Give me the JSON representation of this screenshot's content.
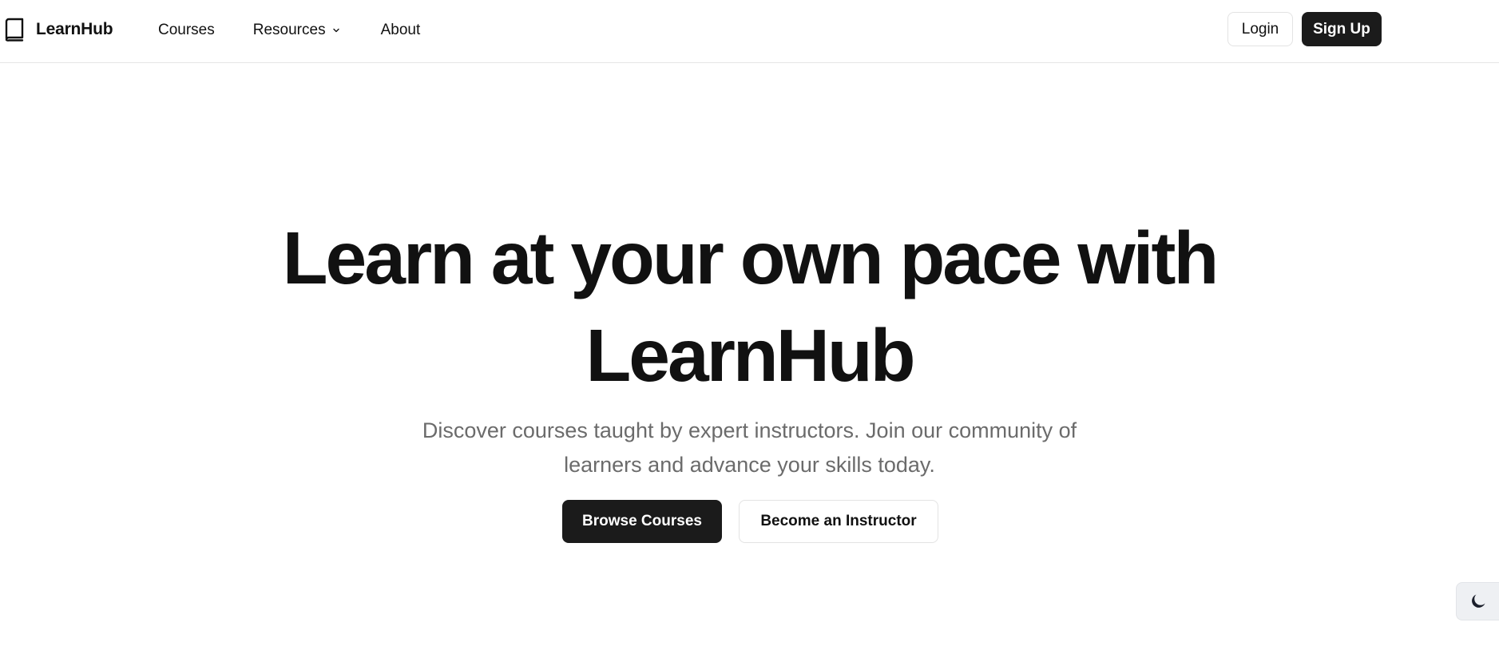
{
  "brand": {
    "name": "LearnHub",
    "icon": "book-icon"
  },
  "nav": {
    "courses": "Courses",
    "resources": "Resources",
    "about": "About"
  },
  "auth": {
    "login": "Login",
    "signup": "Sign Up"
  },
  "hero": {
    "title_line1": "Learn at your own pace with",
    "title_line2": "LearnHub",
    "subtitle_line1": "Discover courses taught by expert instructors. Join our community of",
    "subtitle_line2": "learners and advance your skills today.",
    "primary_cta": "Browse Courses",
    "secondary_cta": "Become an Instructor"
  },
  "theme_toggle": {
    "icon": "moon-icon"
  },
  "colors": {
    "text": "#111111",
    "muted": "#6b6b6b",
    "primary_button": "#1b1b1b",
    "border": "#e3e3e3",
    "toggle_bg": "#eef0f3"
  }
}
